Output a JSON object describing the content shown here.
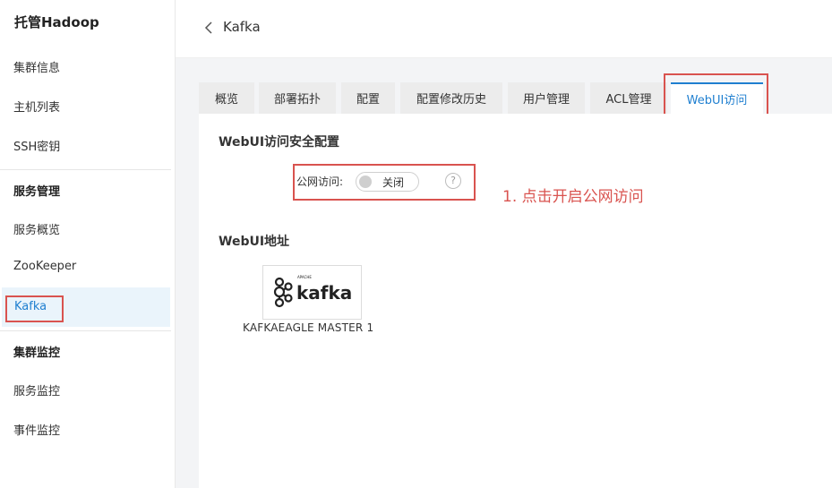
{
  "app_title": "托管Hadoop",
  "sidebar": {
    "items": [
      {
        "label": "集群信息"
      },
      {
        "label": "主机列表"
      },
      {
        "label": "SSH密钥"
      }
    ],
    "group_services": "服务管理",
    "service_items": [
      {
        "label": "服务概览"
      },
      {
        "label": "ZooKeeper"
      },
      {
        "label": "Kafka"
      }
    ],
    "group_monitor": "集群监控",
    "monitor_items": [
      {
        "label": "服务监控"
      },
      {
        "label": "事件监控"
      }
    ]
  },
  "header": {
    "title": "Kafka"
  },
  "tabs": [
    {
      "label": "概览"
    },
    {
      "label": "部署拓扑"
    },
    {
      "label": "配置"
    },
    {
      "label": "配置修改历史"
    },
    {
      "label": "用户管理"
    },
    {
      "label": "ACL管理"
    },
    {
      "label": "WebUI访问"
    }
  ],
  "security": {
    "title": "WebUI访问安全配置",
    "public_label": "公网访问:",
    "toggle_text": "关闭",
    "help": "?"
  },
  "annotation": "1. 点击开启公网访问",
  "webui": {
    "title": "WebUI地址",
    "card_caption": "KAFKAEAGLE MASTER 1",
    "logo_small": "APACHE",
    "logo_text": "kafka"
  },
  "colors": {
    "accent": "#1f7fd0",
    "highlight_box": "#d9534f",
    "active_bg": "#eaf4fb"
  }
}
